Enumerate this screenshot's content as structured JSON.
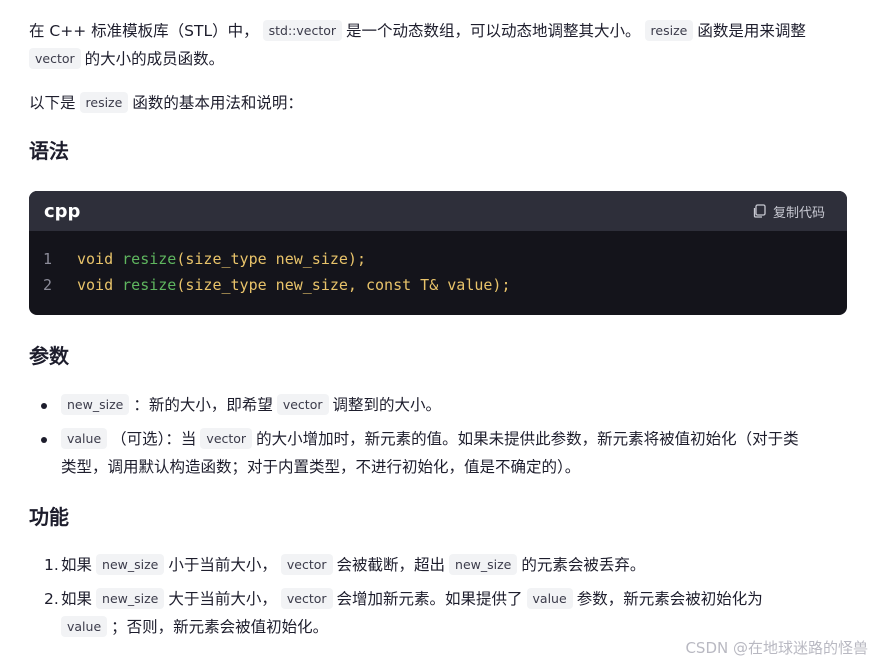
{
  "intro": {
    "p1_a": "在 C++ 标准模板库（STL）中，",
    "p1_code1": "std::vector",
    "p1_b": "是一个动态数组，可以动态地调整其大小。",
    "p1_code2": "resize",
    "p1_c": "函数是用来调整",
    "p1_code3": "vector",
    "p1_d": "的大小的成员函数。",
    "p2_a": "以下是",
    "p2_code": "resize",
    "p2_b": "函数的基本用法和说明："
  },
  "sections": {
    "syntax_title": "语法",
    "params_title": "参数",
    "function_title": "功能"
  },
  "code_block": {
    "language": "cpp",
    "copy_label": "复制代码",
    "lines": [
      {
        "n": "1",
        "kw": "void",
        "fn": "resize",
        "rest": "(size_type new_size);"
      },
      {
        "n": "2",
        "kw": "void",
        "fn": "resize",
        "rest": "(size_type new_size, const T& value);"
      }
    ]
  },
  "params": {
    "item1_code1": "new_size",
    "item1_a": "：新的大小，即希望",
    "item1_code2": "vector",
    "item1_b": "调整到的大小。",
    "item2_code1": "value",
    "item2_a": "（可选）：当",
    "item2_code2": "vector",
    "item2_b": "的大小增加时，新元素的值。如果未提供此参数，新元素将被值初始化（对于类",
    "item2_c": "类型，调用默认构造函数；对于内置类型，不进行初始化，值是不确定的）。"
  },
  "funcs": {
    "item1_num": "1.",
    "item1_a": "如果",
    "item1_code1": "new_size",
    "item1_b": "小于当前大小，",
    "item1_code2": "vector",
    "item1_c": "会被截断，超出",
    "item1_code3": "new_size",
    "item1_d": "的元素会被丢弃。",
    "item2_num": "2.",
    "item2_a": "如果",
    "item2_code1": "new_size",
    "item2_b": "大于当前大小，",
    "item2_code2": "vector",
    "item2_c": "会增加新元素。如果提供了",
    "item2_code3": "value",
    "item2_d": "参数，新元素会被初始化为",
    "item2_code4": "value",
    "item2_e": "；否则，新元素会被值初始化。"
  },
  "watermark": "CSDN @在地球迷路的怪兽"
}
